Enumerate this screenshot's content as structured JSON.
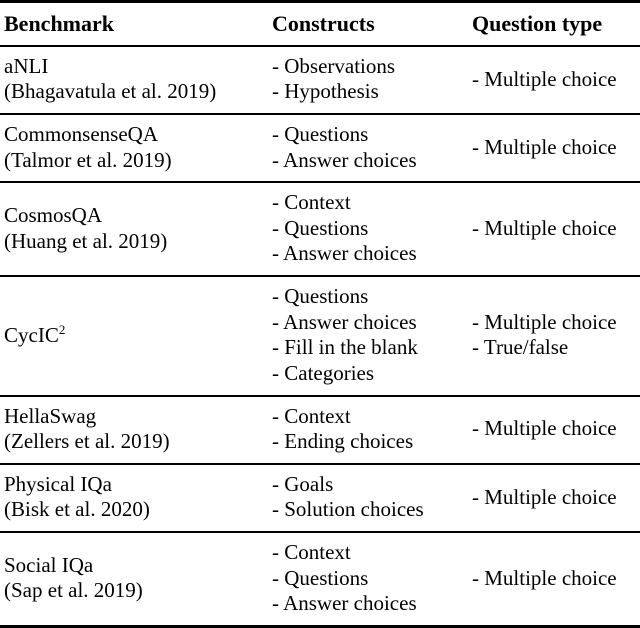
{
  "table": {
    "headers": {
      "benchmark": "Benchmark",
      "constructs": "Constructs",
      "question_type": "Question type"
    },
    "rows": [
      {
        "benchmark_name": "aNLI",
        "benchmark_citation": "(Bhagavatula et al. 2019)",
        "constructs": [
          "- Observations",
          "- Hypothesis"
        ],
        "question_types": [
          "- Multiple choice"
        ]
      },
      {
        "benchmark_name": "CommonsenseQA",
        "benchmark_citation": "(Talmor et al. 2019)",
        "constructs": [
          "- Questions",
          "- Answer choices"
        ],
        "question_types": [
          "- Multiple choice"
        ]
      },
      {
        "benchmark_name": "CosmosQA",
        "benchmark_citation": "(Huang et al. 2019)",
        "constructs": [
          "- Context",
          "- Questions",
          "- Answer choices"
        ],
        "question_types": [
          "- Multiple choice"
        ]
      },
      {
        "benchmark_name": "CycIC",
        "benchmark_name_superscript": "2",
        "benchmark_citation": "",
        "constructs": [
          "- Questions",
          "- Answer choices",
          "- Fill in the blank",
          "- Categories"
        ],
        "question_types": [
          "- Multiple choice",
          "- True/false"
        ]
      },
      {
        "benchmark_name": "HellaSwag",
        "benchmark_citation": "(Zellers et al. 2019)",
        "constructs": [
          "- Context",
          "- Ending choices"
        ],
        "question_types": [
          "- Multiple choice"
        ]
      },
      {
        "benchmark_name": "Physical IQa",
        "benchmark_citation": "(Bisk et al. 2020)",
        "constructs": [
          "- Goals",
          "- Solution choices"
        ],
        "question_types": [
          "- Multiple choice"
        ]
      },
      {
        "benchmark_name": "Social IQa",
        "benchmark_citation": "(Sap et al. 2019)",
        "constructs": [
          "- Context",
          "- Questions",
          "- Answer choices"
        ],
        "question_types": [
          "- Multiple choice"
        ]
      }
    ]
  },
  "colors": {
    "text": "#000000",
    "rule": "#000000",
    "background": "#ffffff"
  }
}
